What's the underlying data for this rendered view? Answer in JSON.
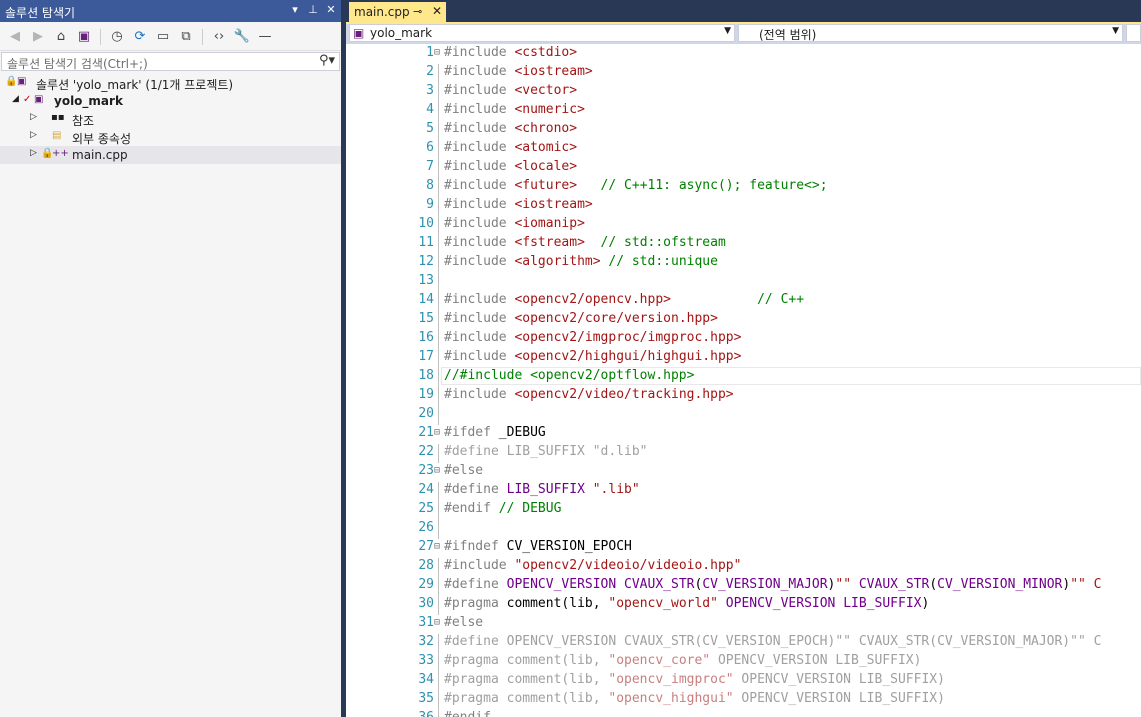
{
  "solution_explorer": {
    "title": "솔루션 탐색기",
    "title_buttons": [
      "▾",
      "⊥",
      "✕"
    ],
    "toolbar_icons": [
      "back-icon",
      "forward-icon",
      "home-icon",
      "vs-icon",
      "history-icon",
      "refresh-icon",
      "collapse-icon",
      "copy-icon",
      "code-icon",
      "wrench-icon",
      "minus-icon"
    ],
    "search_placeholder": "솔루션 탐색기 검색(Ctrl+;)",
    "tree": [
      {
        "label": "솔루션 'yolo_mark' (1/1개 프로젝트)",
        "icon": "solution-icon",
        "level": 0
      },
      {
        "label": "yolo_mark",
        "icon": "project-icon",
        "level": 1,
        "bold": true
      },
      {
        "label": "참조",
        "icon": "references-icon",
        "level": 2
      },
      {
        "label": "외부 종속성",
        "icon": "external-deps-icon",
        "level": 2
      },
      {
        "label": "main.cpp",
        "icon": "cpp-file-icon",
        "level": 2,
        "selected": true
      }
    ]
  },
  "editor": {
    "tab_label": "main.cpp",
    "nav_project": "yolo_mark",
    "nav_scope": "(전역 범위)",
    "colors": {
      "keyword": "#808080",
      "string": "#a31515",
      "comment": "#008000",
      "macro": "#6f008a",
      "plain": "#000000",
      "disabled": "#a0a0a0"
    },
    "lines": [
      {
        "n": "1",
        "fold": "⊟",
        "segs": [
          [
            "#include ",
            "k"
          ],
          [
            "<cstdio>",
            "s"
          ]
        ]
      },
      {
        "n": "2",
        "segs": [
          [
            "#include ",
            "k"
          ],
          [
            "<iostream>",
            "s"
          ]
        ]
      },
      {
        "n": "3",
        "segs": [
          [
            "#include ",
            "k"
          ],
          [
            "<vector>",
            "s"
          ]
        ]
      },
      {
        "n": "4",
        "segs": [
          [
            "#include ",
            "k"
          ],
          [
            "<numeric>",
            "s"
          ]
        ]
      },
      {
        "n": "5",
        "segs": [
          [
            "#include ",
            "k"
          ],
          [
            "<chrono>",
            "s"
          ]
        ]
      },
      {
        "n": "6",
        "segs": [
          [
            "#include ",
            "k"
          ],
          [
            "<atomic>",
            "s"
          ]
        ]
      },
      {
        "n": "7",
        "segs": [
          [
            "#include ",
            "k"
          ],
          [
            "<locale>",
            "s"
          ]
        ]
      },
      {
        "n": "8",
        "segs": [
          [
            "#include ",
            "k"
          ],
          [
            "<future>",
            "s"
          ],
          [
            "   // C++11: async(); feature<>;",
            "c"
          ]
        ]
      },
      {
        "n": "9",
        "segs": [
          [
            "#include ",
            "k"
          ],
          [
            "<iostream>",
            "s"
          ]
        ]
      },
      {
        "n": "10",
        "segs": [
          [
            "#include ",
            "k"
          ],
          [
            "<iomanip>",
            "s"
          ]
        ]
      },
      {
        "n": "11",
        "segs": [
          [
            "#include ",
            "k"
          ],
          [
            "<fstream>",
            "s"
          ],
          [
            "  // std::ofstream",
            "c"
          ]
        ]
      },
      {
        "n": "12",
        "segs": [
          [
            "#include ",
            "k"
          ],
          [
            "<algorithm>",
            "s"
          ],
          [
            " // std::unique",
            "c"
          ]
        ]
      },
      {
        "n": "13",
        "segs": []
      },
      {
        "n": "14",
        "segs": [
          [
            "#include ",
            "k"
          ],
          [
            "<opencv2/opencv.hpp>",
            "s"
          ],
          [
            "           // C++",
            "c"
          ]
        ]
      },
      {
        "n": "15",
        "segs": [
          [
            "#include ",
            "k"
          ],
          [
            "<opencv2/core/version.hpp>",
            "s"
          ]
        ]
      },
      {
        "n": "16",
        "segs": [
          [
            "#include ",
            "k"
          ],
          [
            "<opencv2/imgproc/imgproc.hpp>",
            "s"
          ]
        ]
      },
      {
        "n": "17",
        "segs": [
          [
            "#include ",
            "k"
          ],
          [
            "<opencv2/highgui/highgui.hpp>",
            "s"
          ]
        ]
      },
      {
        "n": "18",
        "cur": true,
        "segs": [
          [
            "//#include <opencv2/optflow.hpp>",
            "c"
          ]
        ]
      },
      {
        "n": "19",
        "segs": [
          [
            "#include ",
            "k"
          ],
          [
            "<opencv2/video/tracking.hpp>",
            "s"
          ]
        ]
      },
      {
        "n": "20",
        "segs": []
      },
      {
        "n": "21",
        "fold": "⊟",
        "segs": [
          [
            "#ifdef ",
            "k"
          ],
          [
            "_DEBUG",
            "p"
          ]
        ]
      },
      {
        "n": "22",
        "segs": [
          [
            "#define LIB_SUFFIX \"d.lib\"",
            "d"
          ]
        ]
      },
      {
        "n": "23",
        "fold": "⊟",
        "segs": [
          [
            "#else",
            "k"
          ]
        ]
      },
      {
        "n": "24",
        "segs": [
          [
            "#define ",
            "k"
          ],
          [
            "LIB_SUFFIX",
            "m"
          ],
          [
            " ",
            "p"
          ],
          [
            "\".lib\"",
            "s"
          ]
        ]
      },
      {
        "n": "25",
        "segs": [
          [
            "#endif ",
            "k"
          ],
          [
            "// DEBUG",
            "c"
          ]
        ]
      },
      {
        "n": "26",
        "segs": []
      },
      {
        "n": "27",
        "fold": "⊟",
        "segs": [
          [
            "#ifndef ",
            "k"
          ],
          [
            "CV_VERSION_EPOCH",
            "p"
          ]
        ]
      },
      {
        "n": "28",
        "segs": [
          [
            "#include ",
            "k"
          ],
          [
            "\"opencv2/videoio/videoio.hpp\"",
            "s"
          ]
        ]
      },
      {
        "n": "29",
        "segs": [
          [
            "#define ",
            "k"
          ],
          [
            "OPENCV_VERSION ",
            "m"
          ],
          [
            "CVAUX_STR",
            "m"
          ],
          [
            "(",
            "p"
          ],
          [
            "CV_VERSION_MAJOR",
            "m"
          ],
          [
            ")",
            "p"
          ],
          [
            "\"\"",
            "s"
          ],
          [
            " ",
            "p"
          ],
          [
            "CVAUX_STR",
            "m"
          ],
          [
            "(",
            "p"
          ],
          [
            "CV_VERSION_MINOR",
            "m"
          ],
          [
            ")",
            "p"
          ],
          [
            "\"\" C",
            "s"
          ]
        ]
      },
      {
        "n": "30",
        "segs": [
          [
            "#pragma ",
            "k"
          ],
          [
            "comment",
            "p"
          ],
          [
            "(lib, ",
            "p"
          ],
          [
            "\"opencv_world\"",
            "s"
          ],
          [
            " ",
            "p"
          ],
          [
            "OPENCV_VERSION ",
            "m"
          ],
          [
            "LIB_SUFFIX",
            "m"
          ],
          [
            ")",
            "p"
          ]
        ]
      },
      {
        "n": "31",
        "fold": "⊟",
        "segs": [
          [
            "#else",
            "k"
          ]
        ]
      },
      {
        "n": "32",
        "segs": [
          [
            "#define OPENCV_VERSION CVAUX_STR(CV_VERSION_EPOCH)\"\" CVAUX_STR(CV_VERSION_MAJOR)\"\" C",
            "d"
          ]
        ]
      },
      {
        "n": "33",
        "segs": [
          [
            "#pragma comment(lib, ",
            "d"
          ],
          [
            "\"opencv_core\"",
            "ds"
          ],
          [
            " OPENCV_VERSION LIB_SUFFIX)",
            "d"
          ]
        ]
      },
      {
        "n": "34",
        "segs": [
          [
            "#pragma comment(lib, ",
            "d"
          ],
          [
            "\"opencv_imgproc\"",
            "ds"
          ],
          [
            " OPENCV_VERSION LIB_SUFFIX)",
            "d"
          ]
        ]
      },
      {
        "n": "35",
        "segs": [
          [
            "#pragma comment(lib, ",
            "d"
          ],
          [
            "\"opencv_highgui\"",
            "ds"
          ],
          [
            " OPENCV_VERSION LIB_SUFFIX)",
            "d"
          ]
        ]
      },
      {
        "n": "36",
        "segs": [
          [
            "#endif",
            "k"
          ]
        ]
      }
    ]
  }
}
